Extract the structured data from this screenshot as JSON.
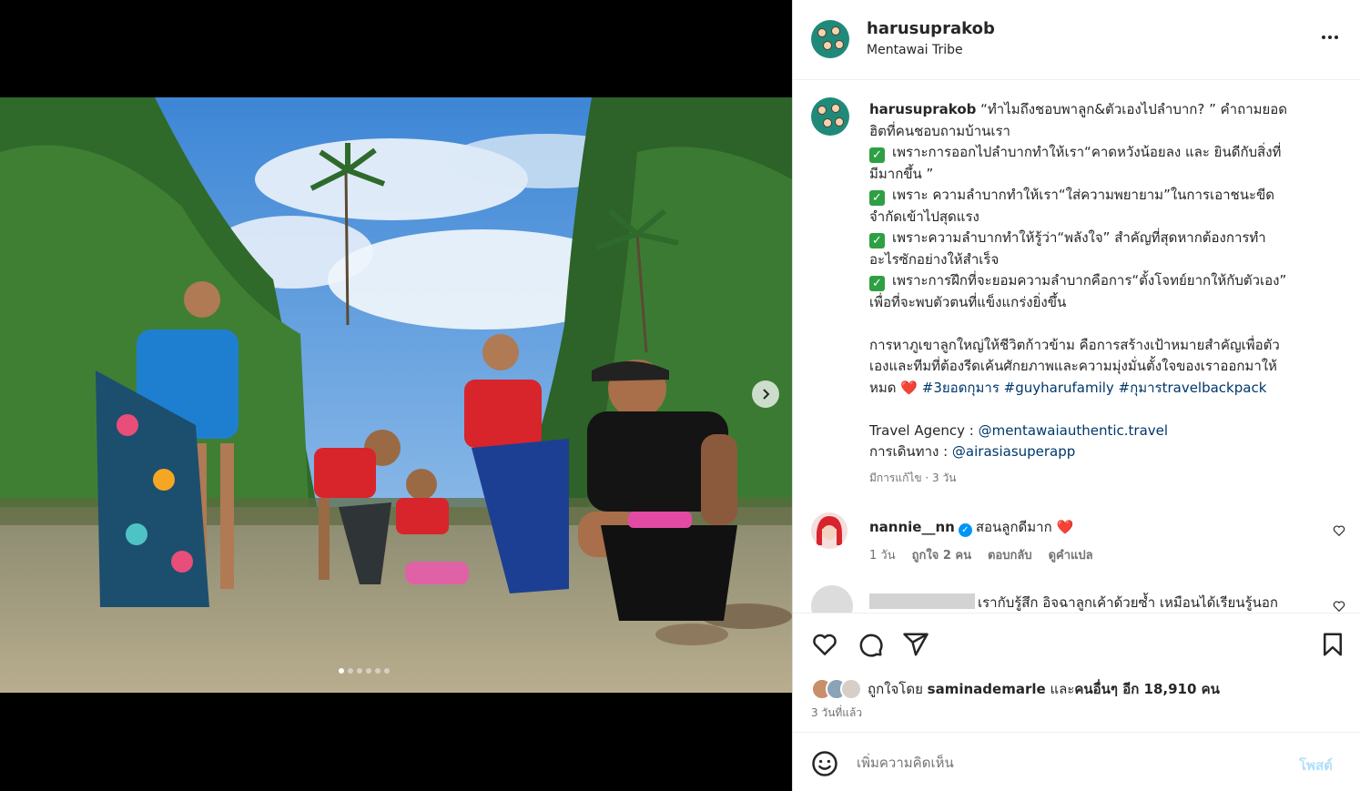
{
  "header": {
    "username": "harusuprakob",
    "location": "Mentawai Tribe"
  },
  "caption": {
    "username": "harusuprakob",
    "line1": "“ทำไมถึงชอบพาลูก&ตัวเองไปลำบาก? ” คำถามยอด",
    "line2": "ฮิตที่คนชอบถามบ้านเรา",
    "line3": "เพราะการออกไปลำบากทำให้เรา“คาดหวังน้อยลง และ ยินดีกับสิ่งที่",
    "line4": "มีมากขึ้น ”",
    "line5": "เพราะ ความลำบากทำให้เรา“ใส่ความพยายาม”ในการเอาชนะขีด",
    "line6": "จำกัดเข้าไปสุดแรง",
    "line7": "เพราะความลำบากทำให้รู้ว่า“พลังใจ” สำคัญที่สุดหากต้องการทำ",
    "line8": "อะไรซักอย่างให้สำเร็จ",
    "line9": "เพราะการฝึกที่จะยอมความลำบากคือการ“ตั้งโจทย์ยากให้กับตัวเอง”",
    "line10": "เพื่อที่จะพบตัวตนที่แข็งแกร่งยิ่งขึ้น",
    "line11": "การหาภูเขาลูกใหญ่ให้ชีวิตก้าวข้าม คือการสร้างเป้าหมายสำคัญเพื่อตัว",
    "line12": "เองและทีมที่ต้องรีดเค้นศักยภาพและความมุ่งมั่นตั้งใจของเราออกมาให้",
    "line13_text": "หมด",
    "line13_heart": "❤️",
    "hashtags": "#3ยอดกุมาร #guyharufamily #กุมารtravelbackpack",
    "agency_label": "Travel Agency : ",
    "agency_link": "@mentawaiauthentic.travel",
    "travel_label": "การเดินทาง : ",
    "travel_link": "@airasiasuperapp",
    "check": "✓",
    "edited": "มีการแก้ไข · 3 วัน"
  },
  "comments": [
    {
      "username": "nannie__nn",
      "verified": "✓",
      "text": "สอนลูกดีมาก",
      "heart": "❤️",
      "time": "1 วัน",
      "likes": "ถูกใจ 2 คน",
      "reply": "ตอบกลับ",
      "translate": "ดูคำแปล"
    },
    {
      "text": "เรากับรู้สึก อิจฉาลูกเค้าด้วยซ้ำ เหมือนได้เรียนรู้นอก"
    }
  ],
  "likes": {
    "prefix": "ถูกใจโดย",
    "user": "saminademarle",
    "and": "และ",
    "others": "คนอื่นๆ อีก 18,910 คน"
  },
  "posted": "3 วันที่แล้ว",
  "composer": {
    "placeholder": "เพิ่มความคิดเห็น",
    "post_label": "โพสต์"
  },
  "carousel": {
    "total": 6,
    "current": 1
  },
  "colors": {
    "link": "#00376b",
    "post_disabled": "#b2dffc",
    "verified": "#0095f6",
    "heart": "#e0245e"
  }
}
